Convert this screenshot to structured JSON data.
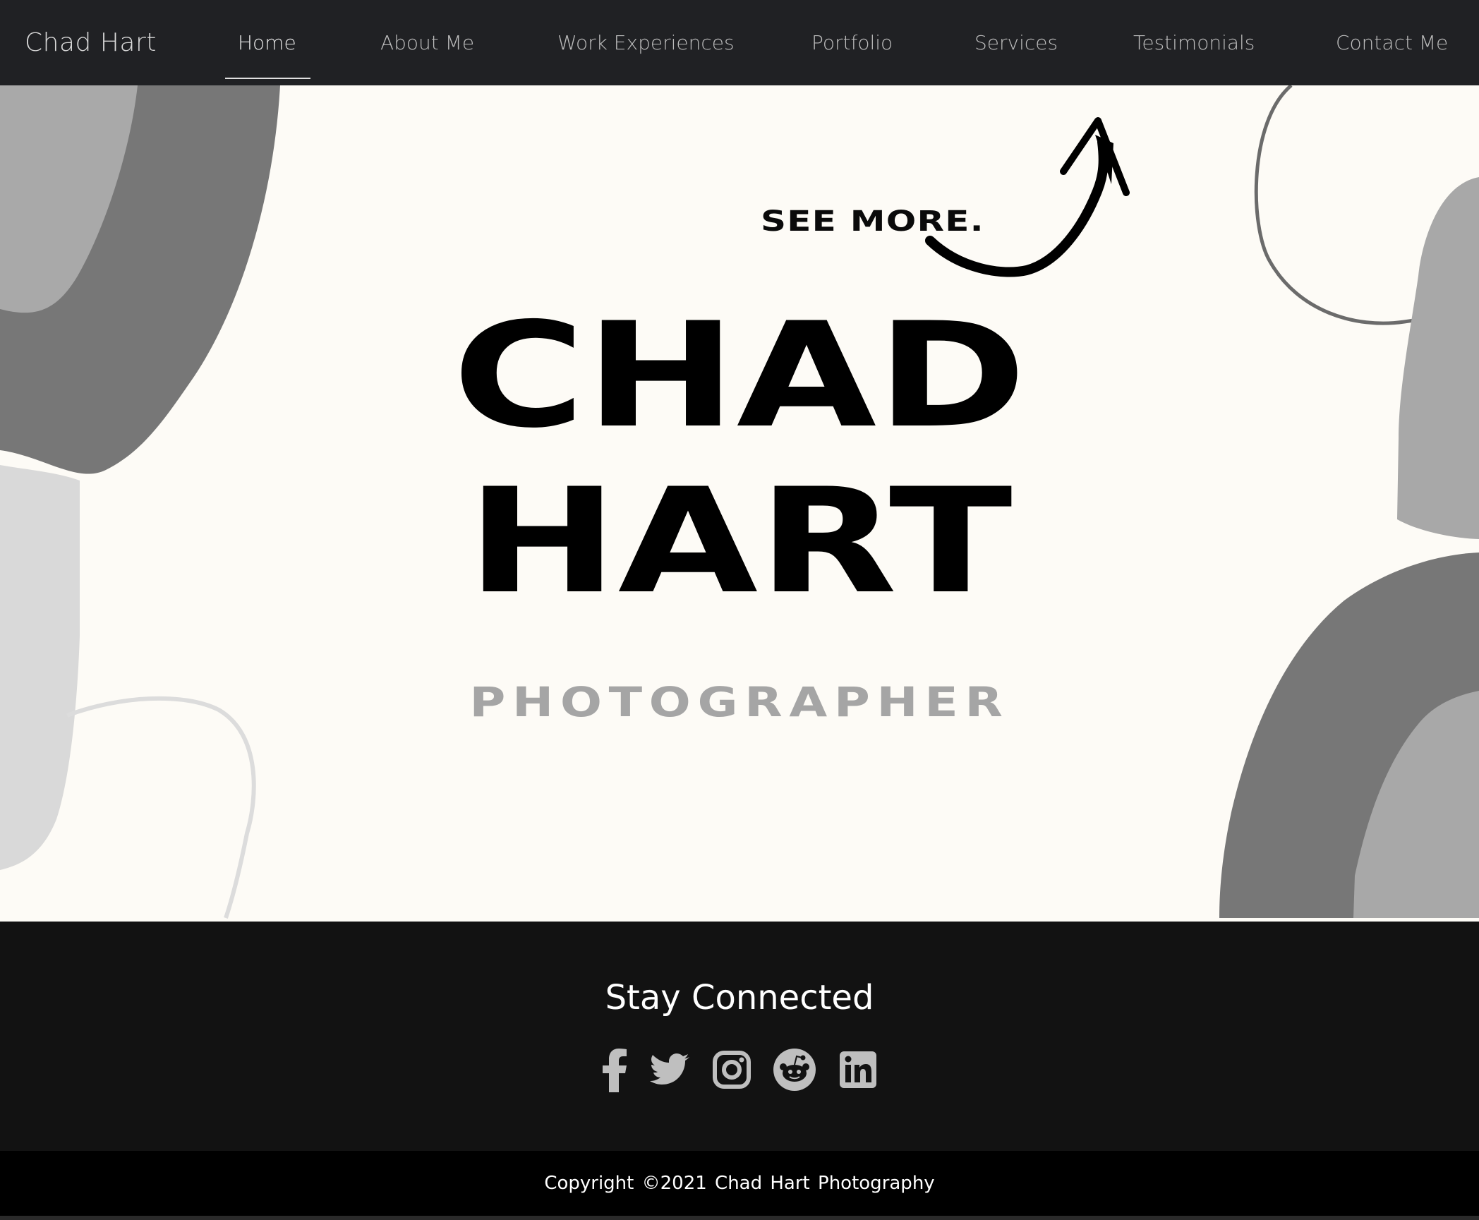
{
  "nav": {
    "brand": "Chad Hart",
    "items": [
      {
        "label": "Home",
        "active": true
      },
      {
        "label": "About Me"
      },
      {
        "label": "Work Experiences"
      },
      {
        "label": "Portfolio"
      },
      {
        "label": "Services"
      },
      {
        "label": "Testimonials"
      },
      {
        "label": "Contact Me"
      }
    ]
  },
  "hero": {
    "see_more": "SEE MORE.",
    "title_line1": "CHAD",
    "title_line2": "HART",
    "subtitle": "PHOTOGRAPHER"
  },
  "connect": {
    "title": "Stay Connected",
    "icons": [
      "facebook-icon",
      "twitter-icon",
      "instagram-icon",
      "reddit-icon",
      "linkedin-icon"
    ]
  },
  "footer": {
    "copyright": "Copyright ©2021 Chad Hart Photography"
  },
  "colors": {
    "nav_bg": "#202124",
    "hero_bg": "#fdfbf6",
    "connect_bg": "#121212",
    "footer_bg": "#000000",
    "icon_color": "#bfbfbf",
    "subtitle_color": "#a5a5a5"
  }
}
